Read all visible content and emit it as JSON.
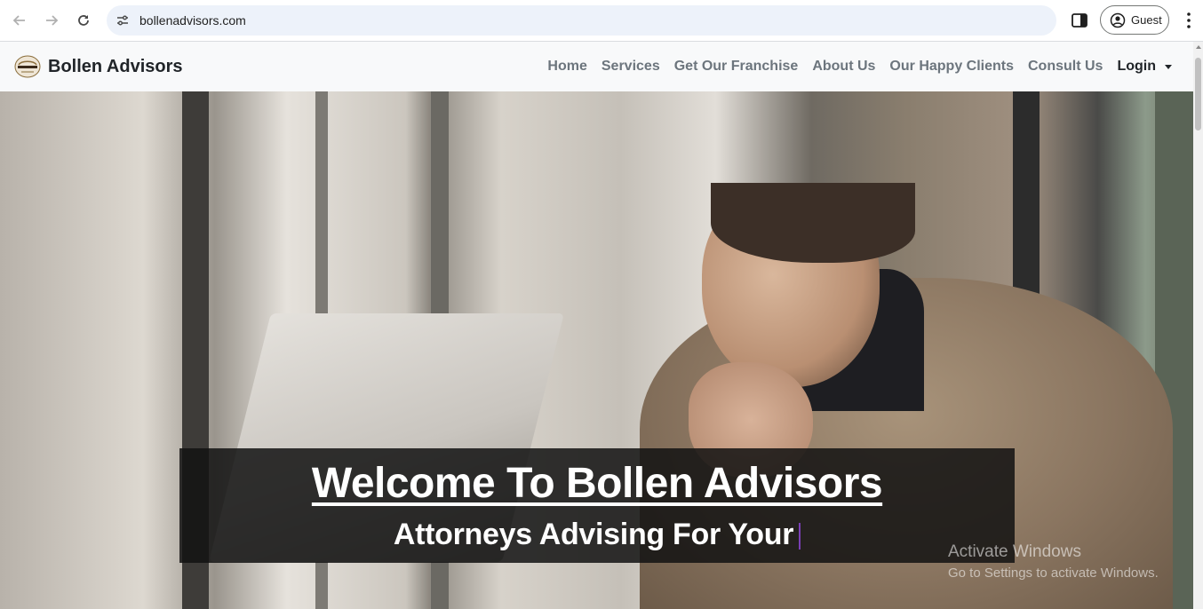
{
  "browser": {
    "url": "bollenadvisors.com",
    "profile_label": "Guest",
    "icons": [
      "back-arrow-icon",
      "forward-arrow-icon",
      "reload-icon",
      "site-settings-icon",
      "side-panel-icon",
      "profile-icon",
      "more-menu-icon"
    ]
  },
  "site": {
    "brand_name": "Bollen Advisors",
    "nav": [
      {
        "label": "Home"
      },
      {
        "label": "Services"
      },
      {
        "label": "Get Our Franchise"
      },
      {
        "label": "About Us"
      },
      {
        "label": "Our Happy Clients"
      },
      {
        "label": "Consult Us"
      }
    ],
    "login_label": "Login"
  },
  "hero": {
    "title": "Welcome To Bollen Advisors",
    "subtitle": "Attorneys Advising For Your"
  },
  "watermark": {
    "title": "Activate Windows",
    "subtitle": "Go to Settings to activate Windows."
  },
  "colors": {
    "nav_bg": "#f8f9fa",
    "nav_link": "#6c757d",
    "cursor": "#7a3fb5"
  }
}
